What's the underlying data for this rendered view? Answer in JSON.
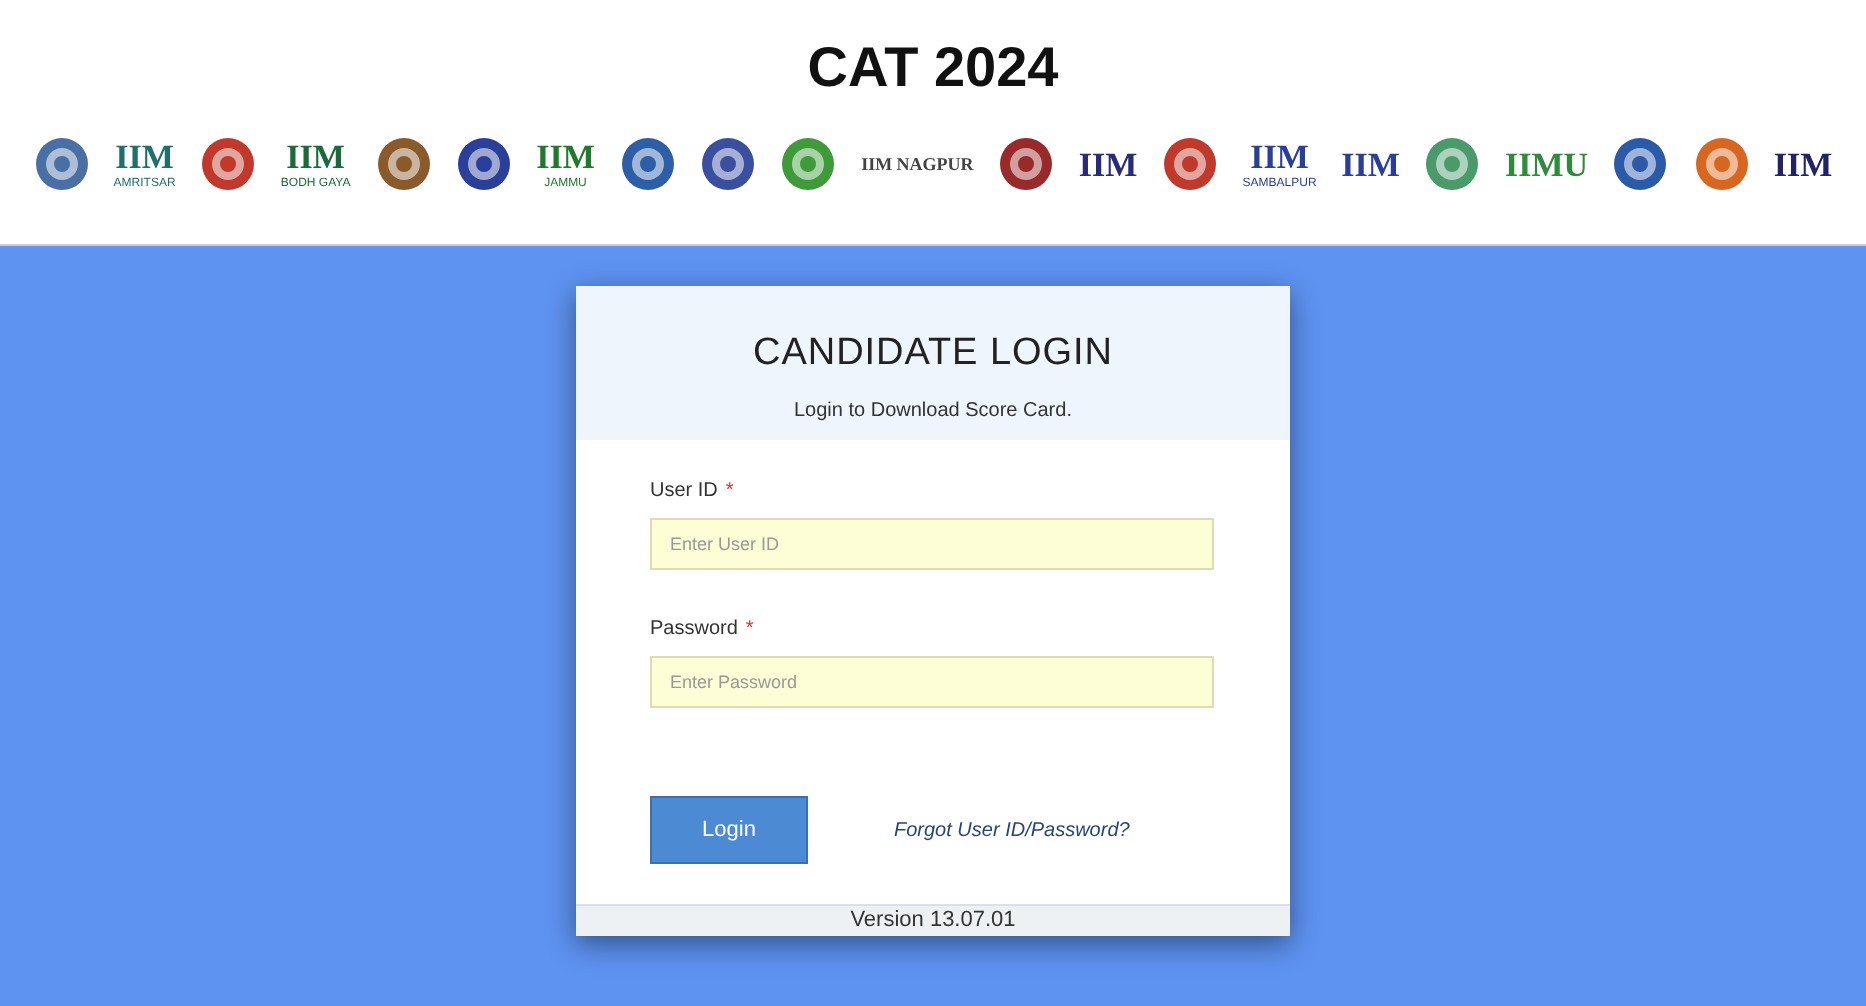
{
  "title": "CAT 2024",
  "logos": [
    {
      "kind": "emblem",
      "color": "#4a6fa5"
    },
    {
      "kind": "wordmark",
      "text": "IIM",
      "sub": "AMRITSAR",
      "color": "#1f6f6a"
    },
    {
      "kind": "emblem",
      "color": "#c0392b"
    },
    {
      "kind": "wordmark",
      "text": "IIM",
      "sub": "BODH GAYA",
      "color": "#1a6b3a"
    },
    {
      "kind": "emblem",
      "color": "#8a5a2b"
    },
    {
      "kind": "emblem",
      "color": "#2a3f9a"
    },
    {
      "kind": "wordmark",
      "text": "IIM",
      "sub": "JAMMU",
      "color": "#1f7a2a"
    },
    {
      "kind": "emblem",
      "color": "#2d5fa8"
    },
    {
      "kind": "emblem",
      "color": "#3b4fa0"
    },
    {
      "kind": "emblem",
      "color": "#3f9a3a"
    },
    {
      "kind": "wordmark",
      "text": "IIM NAGPUR",
      "color": "#444444"
    },
    {
      "kind": "emblem",
      "color": "#9a2a2a"
    },
    {
      "kind": "wordmark",
      "text": "IIM",
      "color": "#2a2a7a"
    },
    {
      "kind": "emblem",
      "color": "#c0392b"
    },
    {
      "kind": "wordmark",
      "text": "IIM",
      "sub": "SAMBALPUR",
      "color": "#2a3f9a"
    },
    {
      "kind": "wordmark",
      "text": "IIM",
      "color": "#2a3f9a"
    },
    {
      "kind": "emblem",
      "color": "#4a9a6a"
    },
    {
      "kind": "wordmark",
      "text": "IIMU",
      "color": "#2f8a3a"
    },
    {
      "kind": "emblem",
      "color": "#2a5aa8"
    },
    {
      "kind": "emblem",
      "color": "#d9661f"
    },
    {
      "kind": "wordmark",
      "text": "IIM",
      "color": "#222266"
    }
  ],
  "card": {
    "heading": "CANDIDATE LOGIN",
    "subheading": "Login to Download Score Card.",
    "fields": [
      {
        "label": "User ID",
        "required_mark": "*",
        "placeholder": "Enter User ID"
      },
      {
        "label": "Password",
        "required_mark": "*",
        "placeholder": "Enter Password"
      }
    ],
    "button": "Login",
    "link": "Forgot User ID/Password?",
    "version": "Version 13.07.01"
  }
}
